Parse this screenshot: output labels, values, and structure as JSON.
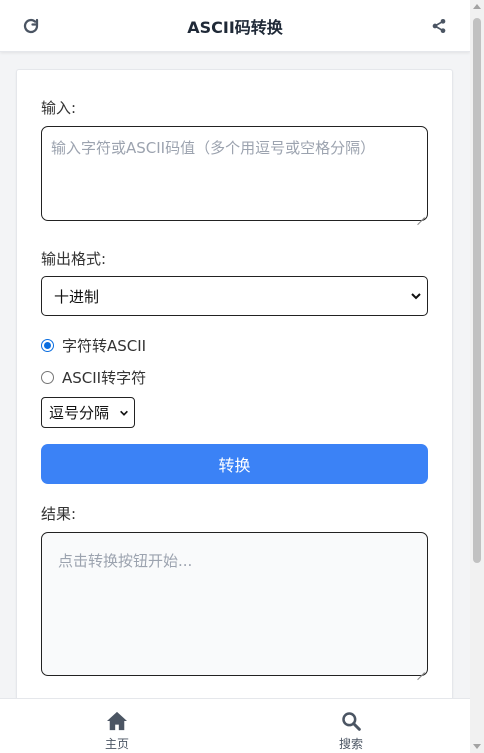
{
  "header": {
    "title": "ASCII码转换",
    "refresh_icon": "refresh-icon",
    "share_icon": "share-icon"
  },
  "form": {
    "input_label": "输入:",
    "input_placeholder": "输入字符或ASCII码值（多个用逗号或空格分隔）",
    "input_value": "",
    "format_label": "输出格式:",
    "format_selected": "十进制",
    "mode_options": [
      {
        "label": "字符转ASCII",
        "checked": true
      },
      {
        "label": "ASCII转字符",
        "checked": false
      }
    ],
    "separator_selected": "逗号分隔",
    "convert_button": "转换",
    "result_label": "结果:",
    "result_placeholder": "点击转换按钮开始..."
  },
  "bottom_nav": {
    "items": [
      {
        "label": "主页",
        "icon": "home-icon"
      },
      {
        "label": "搜索",
        "icon": "search-icon"
      }
    ]
  },
  "colors": {
    "accent": "#3b82f6",
    "radio_checked": "#0b6ee0"
  }
}
